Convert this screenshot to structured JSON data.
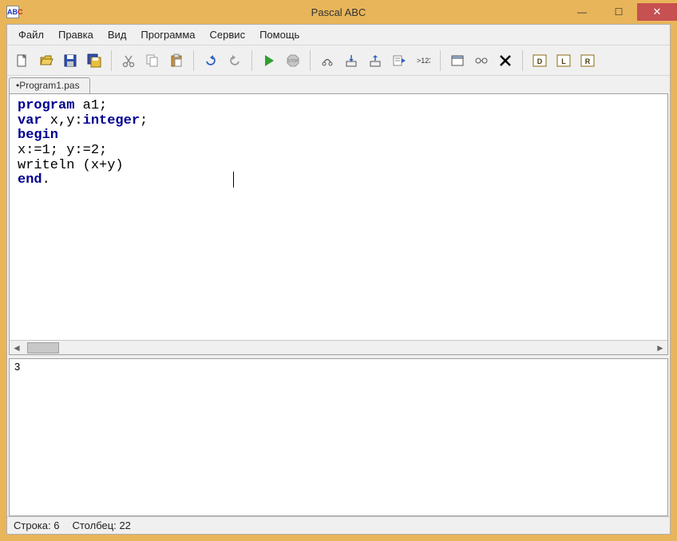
{
  "window": {
    "title": "Pascal ABC"
  },
  "winbtns": {
    "min": "—",
    "max": "☐",
    "close": "✕"
  },
  "menu": {
    "file": "Файл",
    "edit": "Правка",
    "view": "Вид",
    "program": "Программа",
    "service": "Сервис",
    "help": "Помощь"
  },
  "tab": {
    "name": "•Program1.pas"
  },
  "code": {
    "l1a": "program",
    "l1b": " a1;",
    "l2a": "var",
    "l2b": " x,y:",
    "l2c": "integer",
    "l2d": ";",
    "l3": "begin",
    "l4": "x:=1; y:=2;",
    "l5": "writeln (x+y)",
    "l6a": "end",
    "l6b": "."
  },
  "output": {
    "text": "3"
  },
  "status": {
    "line_label": "Строка:",
    "line_val": "6",
    "col_label": "Столбец:",
    "col_val": "22"
  }
}
